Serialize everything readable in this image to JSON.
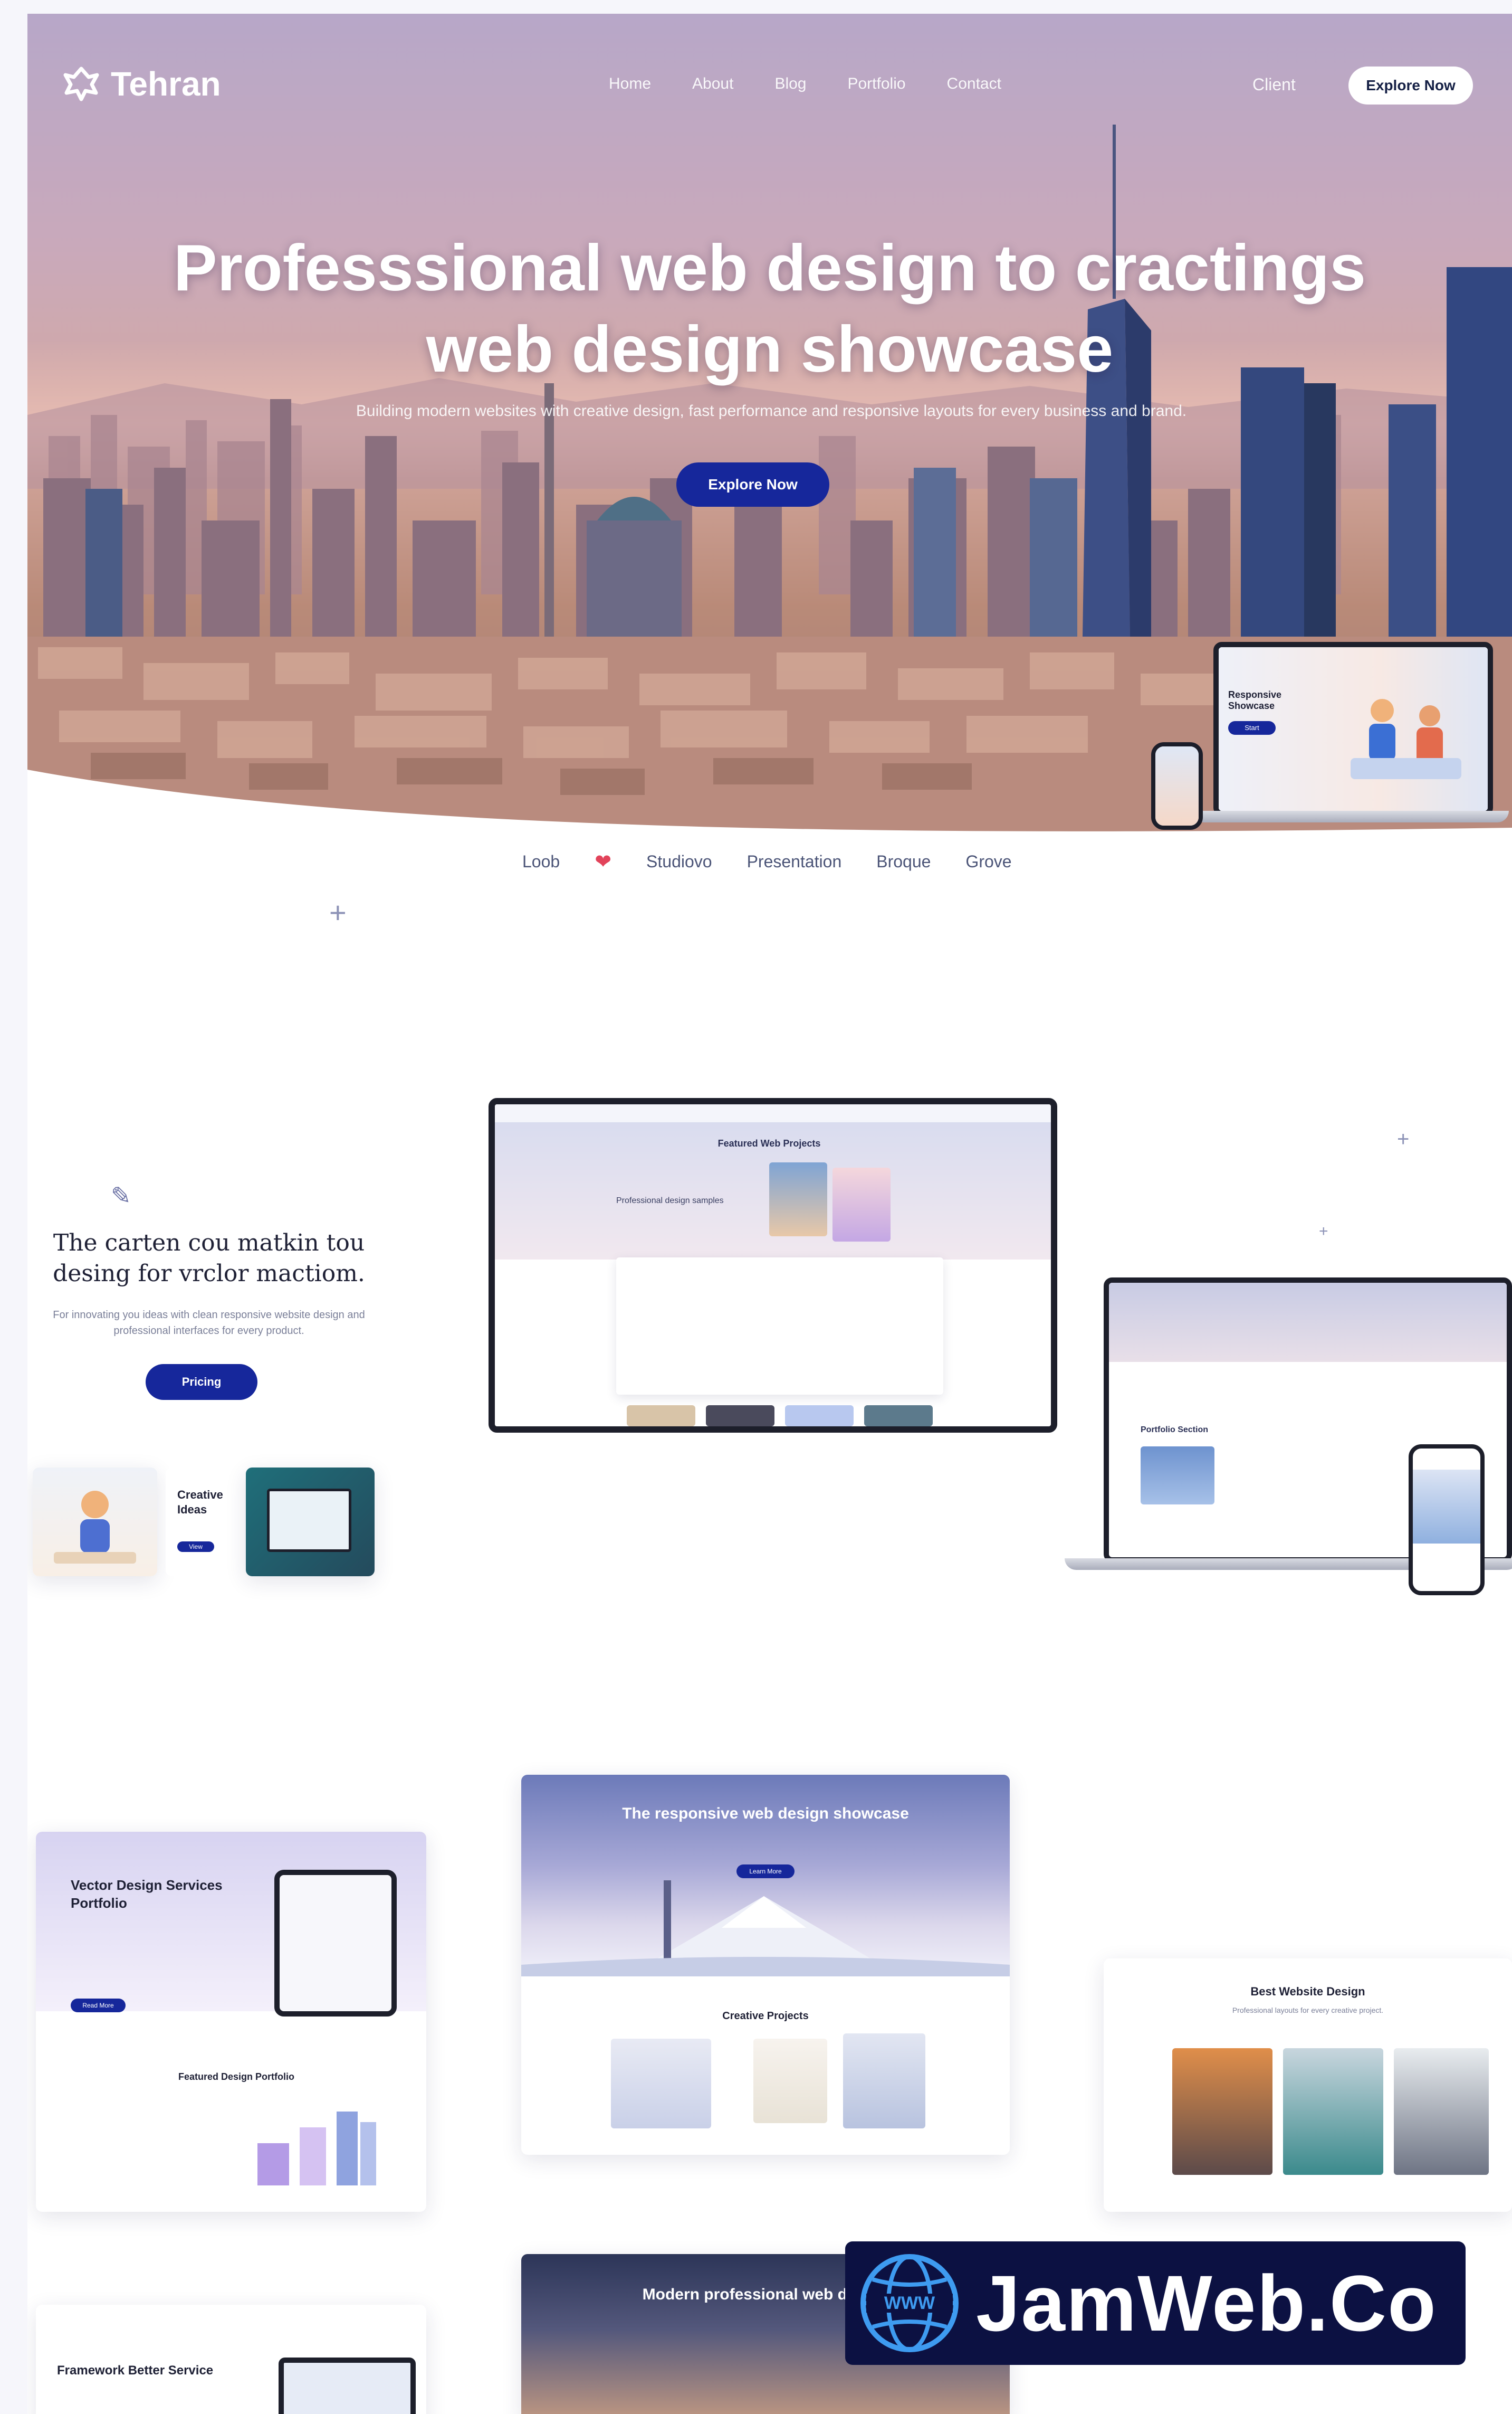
{
  "nav": {
    "logo": "Tehran",
    "links": [
      "Home",
      "About",
      "Blog",
      "Portfolio",
      "Contact"
    ],
    "login": "Client",
    "cta": "Explore Now"
  },
  "hero": {
    "title_line1": "Professsional web design to cractings",
    "title_line2": "web design showcase",
    "subtitle": "Building modern websites with creative design, fast performance and responsive layouts for every business and brand.",
    "button": "Explore Now",
    "laptop_heading": "Responsive Showcase",
    "laptop_button": "Start"
  },
  "clients": [
    "Loob",
    "Studiovo",
    "Presentation",
    "Broque",
    "Grove"
  ],
  "feature": {
    "title": "The carten cou matkin tou desing for vrclor mactiom.",
    "text": "For innovating you ideas with clean responsive website design and professional interfaces for every product.",
    "button": "Pricing",
    "tile_title": "Creative Ideas",
    "tile_button": "View"
  },
  "showcase": {
    "monitor_heading": "Featured Web Projects",
    "monitor_sub": "Professional design samples",
    "laptop_heading": "Portfolio Section"
  },
  "grid": {
    "card1_title": "Vector Design Services Portfolio",
    "card1_button": "Read More",
    "card1_sub": "Featured Design Portfolio",
    "card2_title": "The responsive web design showcase",
    "card2_button": "Learn More",
    "card2_sub": "Creative Projects",
    "card3_title": "Best Website Design",
    "card3_text": "Professional layouts for every creative project.",
    "card4_title": "Framework Better Service",
    "card5_title": "Modern professional web design"
  },
  "watermark": "JamWeb.Co",
  "colors": {
    "accent": "#16279b",
    "watermark_bg": "#0c1142",
    "globe": "#3e9bf0"
  }
}
